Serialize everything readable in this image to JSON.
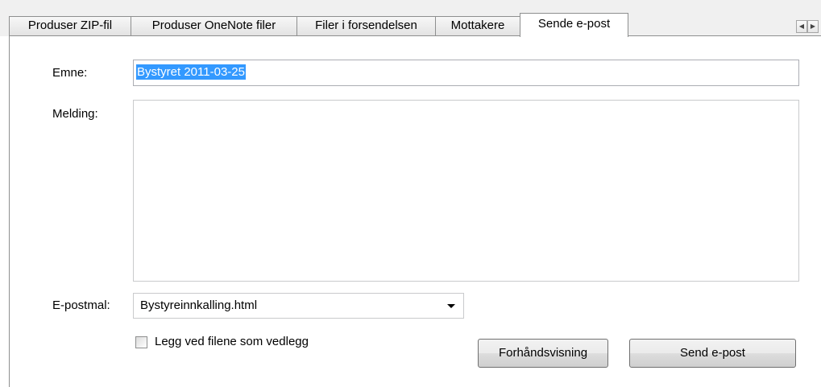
{
  "tabs": [
    {
      "label": "Produser ZIP-fil",
      "active": false
    },
    {
      "label": "Produser OneNote filer",
      "active": false
    },
    {
      "label": "Filer i forsendelsen",
      "active": false
    },
    {
      "label": "Mottakere",
      "active": false
    },
    {
      "label": "Sende e-post",
      "active": true
    }
  ],
  "tab_scroll": {
    "left_icon": "chevron-left-icon",
    "right_icon": "chevron-right-icon",
    "left_glyph": "◀",
    "right_glyph": "▶"
  },
  "form": {
    "subject_label": "Emne:",
    "subject_value": "Bystyret 2011-03-25",
    "message_label": "Melding:",
    "message_value": "",
    "template_label": "E-postmal:",
    "template_value": "Bystyreinnkalling.html",
    "attach_label": "Legg ved filene som vedlegg",
    "attach_checked": false
  },
  "buttons": {
    "preview_label": "Forhåndsvisning",
    "send_label": "Send e-post"
  },
  "colors": {
    "selection": "#3399ff",
    "panel_bg": "#ffffff",
    "strip_bg": "#f0f0f0"
  }
}
